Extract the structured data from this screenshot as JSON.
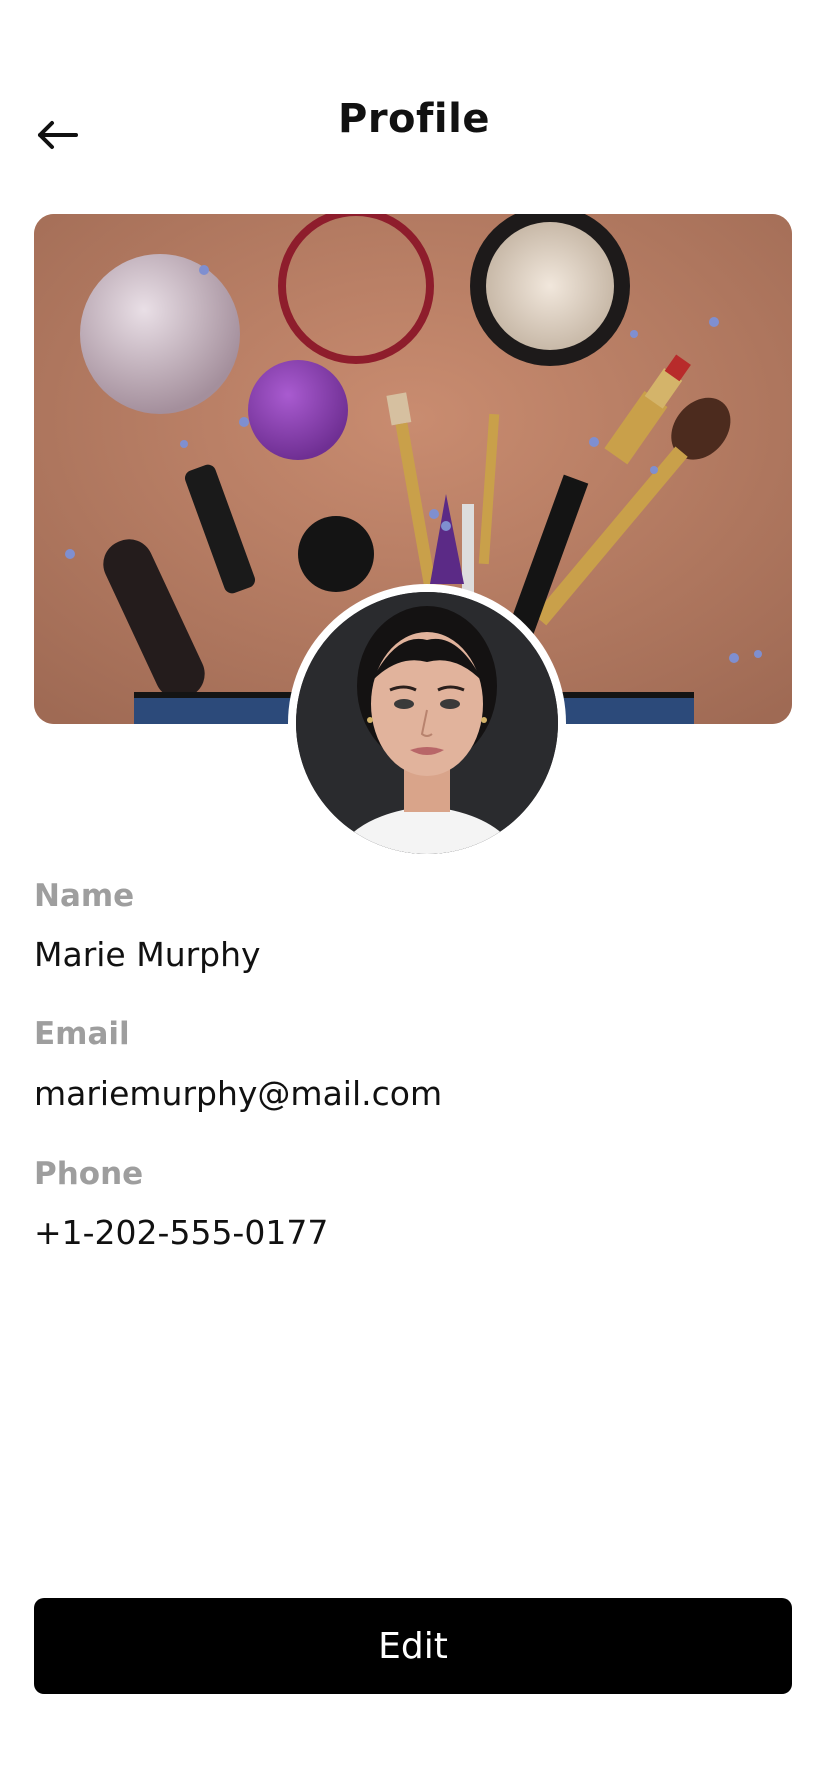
{
  "header": {
    "title": "Profile",
    "back_icon": "arrow-left-icon"
  },
  "banner": {
    "image_subject": "makeup products on peach background"
  },
  "avatar": {
    "image_subject": "portrait of woman"
  },
  "fields": {
    "name": {
      "label": "Name",
      "value": "Marie Murphy"
    },
    "email": {
      "label": "Email",
      "value": "mariemurphy@mail.com"
    },
    "phone": {
      "label": "Phone",
      "value": "+1-202-555-0177"
    }
  },
  "actions": {
    "edit_label": "Edit"
  },
  "colors": {
    "label_gray": "#9e9e9e",
    "button_bg": "#000000",
    "button_text": "#ffffff",
    "banner_bg": "#b87d63"
  }
}
